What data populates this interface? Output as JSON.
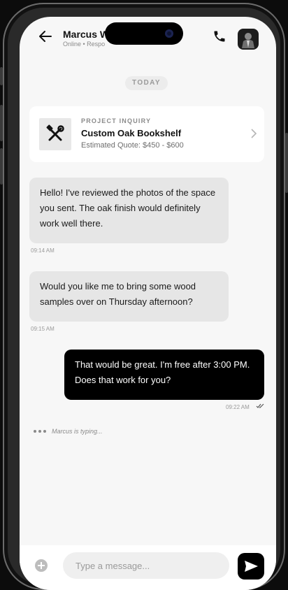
{
  "header": {
    "name": "Marcus We",
    "status": "Online • Respo",
    "icons": {
      "back": "arrow-left-icon",
      "call": "phone-icon",
      "avatar": "avatar"
    }
  },
  "date_divider": "TODAY",
  "project_card": {
    "kicker": "PROJECT INQUIRY",
    "title": "Custom Oak Bookshelf",
    "subtitle": "Estimated Quote: $450 - $600",
    "icon": "tools-icon"
  },
  "messages": [
    {
      "sender": "Marcus",
      "direction": "incoming",
      "text": "Hello! I've reviewed the photos of the space you sent. The oak finish would definitely work well there.",
      "time": "09:14 AM"
    },
    {
      "sender": "Marcus",
      "direction": "incoming",
      "text": "Would you like me to bring some wood samples over on Thursday afternoon?",
      "time": "09:15 AM"
    },
    {
      "sender": "me",
      "direction": "outgoing",
      "text": "That would be great. I'm free after 3:00 PM. Does that work for you?",
      "time": "09:22 AM",
      "read": true
    }
  ],
  "typing_indicator": "Marcus is typing...",
  "composer": {
    "placeholder": "Type a message..."
  },
  "colors": {
    "accent": "#000000",
    "incoming_bubble": "#e6e6e6",
    "background": "#f7f7f7"
  }
}
